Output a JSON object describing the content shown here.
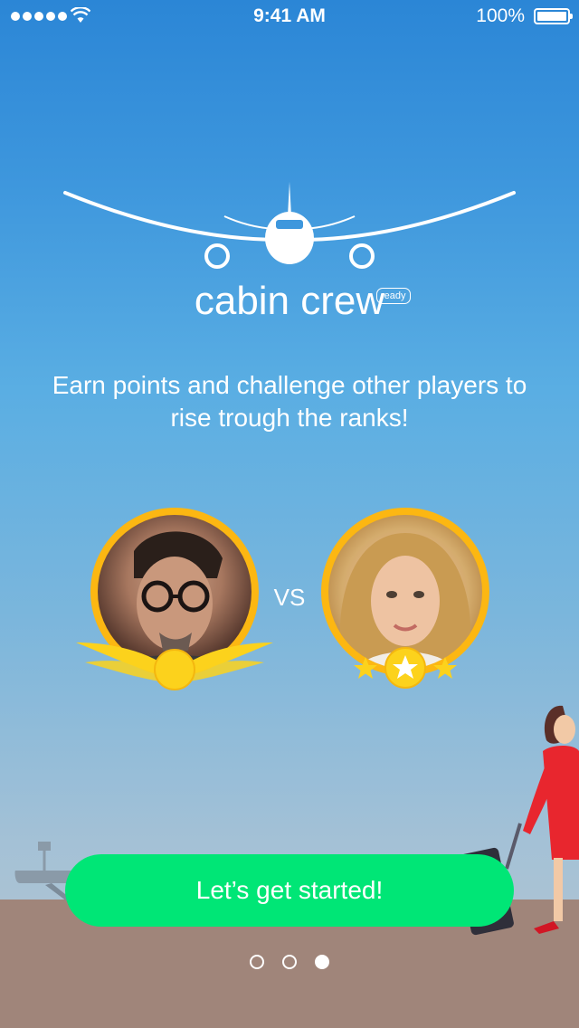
{
  "status_bar": {
    "time": "9:41 AM",
    "battery": "100%"
  },
  "app": {
    "name": "cabin crew",
    "badge": "ready"
  },
  "tagline": "Earn points and challenge other players to rise trough the ranks!",
  "versus": {
    "label": "VS"
  },
  "cta": {
    "label": "Let’s get started!"
  },
  "pager": {
    "pages": 3,
    "current": 3
  },
  "colors": {
    "accent_green": "#00e676",
    "ring_gold": "#fcb712",
    "star_gold": "#fcd21c"
  }
}
